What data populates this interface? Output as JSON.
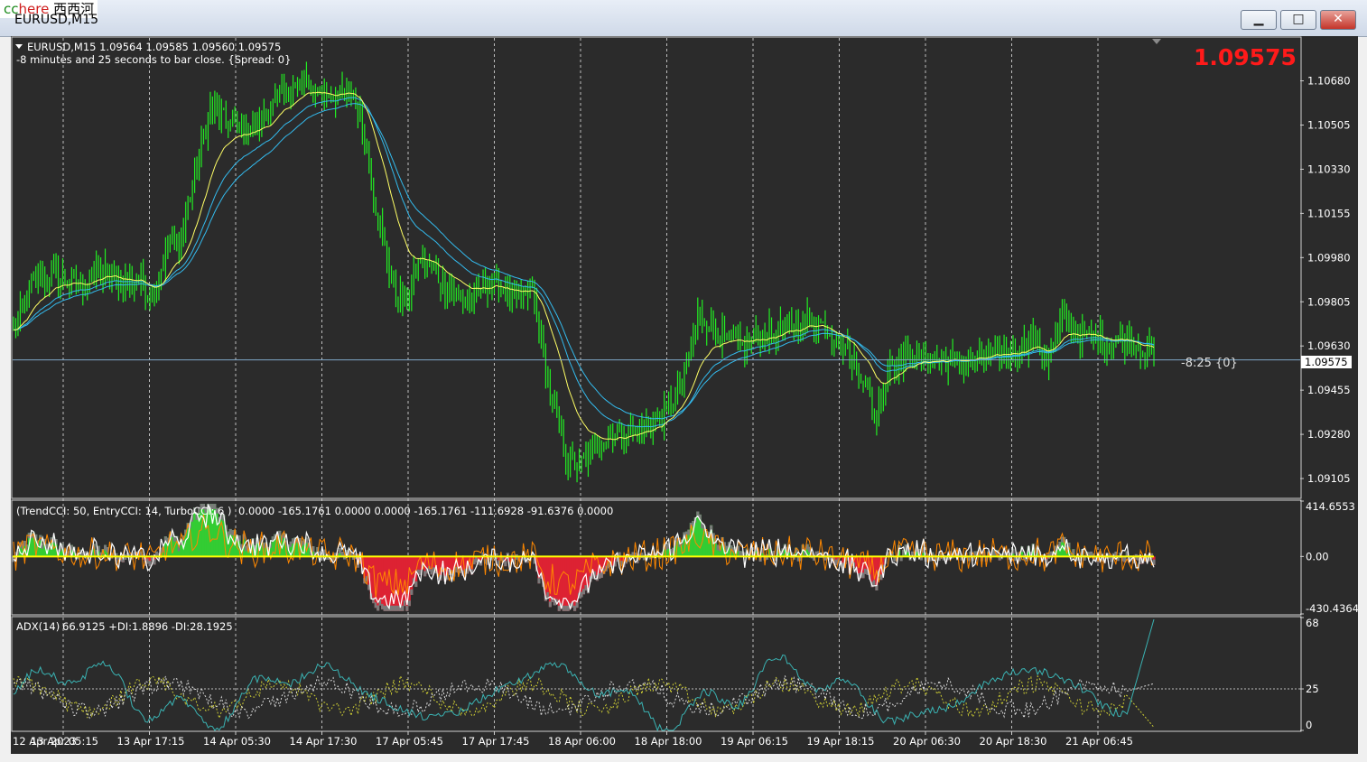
{
  "window": {
    "logo_cc": "cc",
    "logo_here": "here",
    "logo_cn": "西西河",
    "title": "EURUSD,M15",
    "minimize_glyph": "▁",
    "maximize_glyph": "□",
    "close_glyph": "✕"
  },
  "info": {
    "line1": "EURUSD,M15  1.09564 1.09585 1.09560 1.09575",
    "line2": "-8 minutes and 25 seconds to bar close. {Spread: 0}",
    "big_price": "1.09575",
    "countdown": "-8:25 {0}",
    "price_tag": "1.09575"
  },
  "colors": {
    "background": "#2b2b2b",
    "candle": "#22ee22",
    "ma_fast": "#ffff66",
    "ma_slow": "#33bbee",
    "big_price": "#ff1a1a",
    "cci_pos": "#33cc33",
    "cci_neg": "#dd2233",
    "cci_turbo": "#ff8800",
    "cci_zero": "#ffff00",
    "adx_main": "#3ab3b3",
    "adx_plus": "#cccc33",
    "adx_minus": "#dddddd"
  },
  "chart_data": [
    {
      "type": "candlestick",
      "title": "EURUSD,M15",
      "y_ticks": [
        "1.10680",
        "1.10505",
        "1.10330",
        "1.10155",
        "1.09980",
        "1.09805",
        "1.09630",
        "1.09455",
        "1.09280",
        "1.09105"
      ],
      "ylim": [
        1.0903,
        1.1085
      ],
      "current_price": 1.09575,
      "close_path": [
        [
          0,
          1.0968
        ],
        [
          8,
          1.0988
        ],
        [
          18,
          1.0991
        ],
        [
          30,
          1.0987
        ],
        [
          40,
          1.0993
        ],
        [
          48,
          1.0988
        ],
        [
          56,
          1.0989
        ],
        [
          62,
          1.0983
        ],
        [
          70,
          1.1005
        ],
        [
          75,
          1.1005
        ],
        [
          80,
          1.1028
        ],
        [
          88,
          1.1058
        ],
        [
          95,
          1.1052
        ],
        [
          100,
          1.1049
        ],
        [
          108,
          1.105
        ],
        [
          115,
          1.1056
        ],
        [
          120,
          1.1063
        ],
        [
          130,
          1.1067
        ],
        [
          138,
          1.1063
        ],
        [
          146,
          1.1062
        ],
        [
          152,
          1.1063
        ],
        [
          156,
          1.105
        ],
        [
          162,
          1.1019
        ],
        [
          170,
          1.0985
        ],
        [
          176,
          1.098
        ],
        [
          182,
          1.0998
        ],
        [
          190,
          1.099
        ],
        [
          198,
          1.0984
        ],
        [
          205,
          1.0981
        ],
        [
          212,
          1.0988
        ],
        [
          218,
          1.0987
        ],
        [
          224,
          1.098
        ],
        [
          232,
          1.0985
        ],
        [
          240,
          1.0944
        ],
        [
          248,
          1.0917
        ],
        [
          254,
          1.0916
        ],
        [
          262,
          1.0925
        ],
        [
          270,
          1.0928
        ],
        [
          280,
          1.093
        ],
        [
          290,
          1.0935
        ],
        [
          300,
          1.095
        ],
        [
          306,
          1.0975
        ],
        [
          312,
          1.0972
        ],
        [
          318,
          1.0965
        ],
        [
          326,
          1.0963
        ],
        [
          334,
          1.0967
        ],
        [
          342,
          1.0969
        ],
        [
          350,
          1.0971
        ],
        [
          356,
          1.0974
        ],
        [
          364,
          1.097
        ],
        [
          372,
          1.0962
        ],
        [
          380,
          1.095
        ],
        [
          386,
          1.0935
        ],
        [
          392,
          1.0957
        ],
        [
          400,
          1.0959
        ],
        [
          410,
          1.0958
        ],
        [
          420,
          1.0957
        ],
        [
          430,
          1.0958
        ],
        [
          440,
          1.0959
        ],
        [
          448,
          1.0962
        ],
        [
          456,
          1.0966
        ],
        [
          462,
          1.0958
        ],
        [
          470,
          1.0975
        ],
        [
          476,
          1.0967
        ],
        [
          484,
          1.0966
        ],
        [
          492,
          1.0965
        ],
        [
          498,
          1.0966
        ],
        [
          506,
          1.0962
        ],
        [
          510,
          1.09575
        ]
      ]
    },
    {
      "type": "line",
      "title": "(TrendCCI: 50, EntryCCI: 14, TurboCCI: 6 )",
      "values_text": "0.0000 -165.1761 0.0000 0.0000 -165.1761 -111.6928 -91.6376 0.0000",
      "y_ticks": [
        "414.6553",
        "0.00",
        "-430.4364"
      ],
      "ylim": [
        -430.4364,
        414.6553
      ]
    },
    {
      "type": "line",
      "title": "ADX(14)",
      "values_text": "66.9125 +DI:1.8896 -DI:28.1925",
      "adx": 66.9125,
      "plus_di": 1.8896,
      "minus_di": 28.1925,
      "y_ticks": [
        "68",
        "25",
        "0"
      ],
      "ylim": [
        0,
        68
      ],
      "level": 25
    }
  ],
  "x_ticks": [
    "12 Apr 2023",
    "13 Apr 05:15",
    "13 Apr 17:15",
    "14 Apr 05:30",
    "14 Apr 17:30",
    "17 Apr 05:45",
    "17 Apr 17:45",
    "18 Apr 06:00",
    "18 Apr 18:00",
    "19 Apr 06:15",
    "19 Apr 18:15",
    "20 Apr 06:30",
    "20 Apr 18:30",
    "21 Apr 06:45"
  ]
}
